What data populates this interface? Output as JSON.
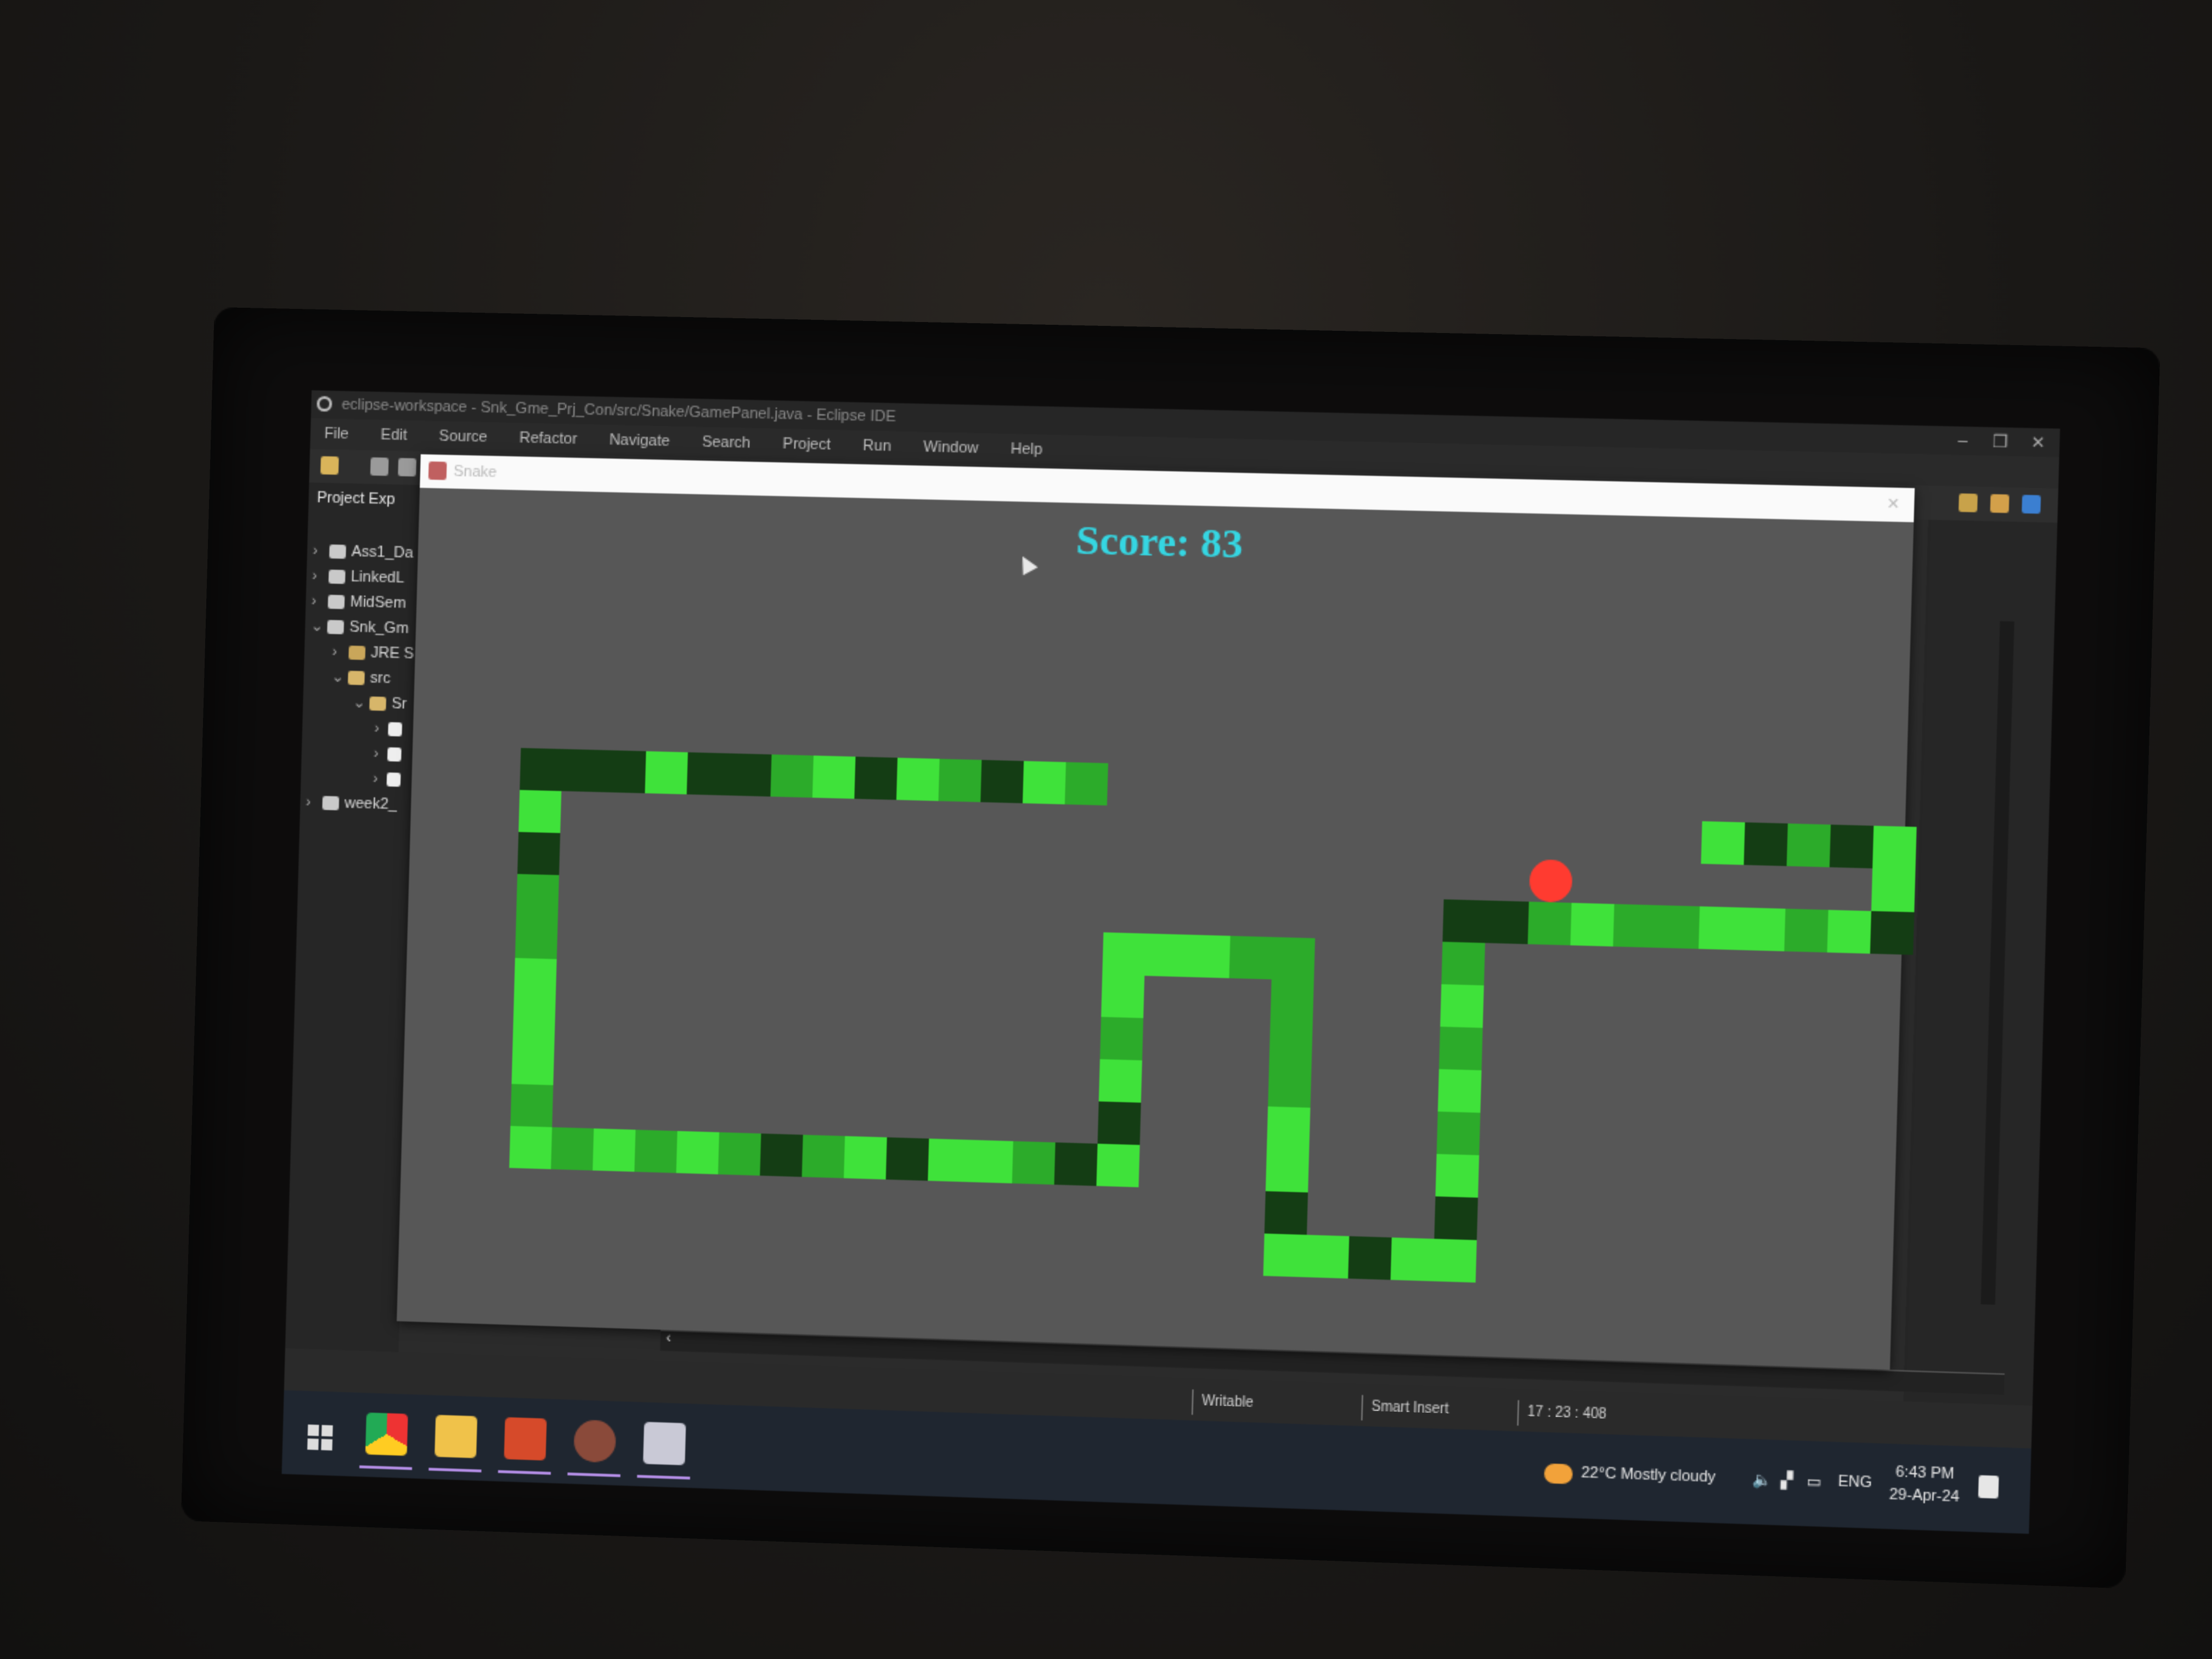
{
  "window": {
    "title": "eclipse-workspace - Snk_Gme_Prj_Con/src/Snake/GamePanel.java - Eclipse IDE",
    "controls": [
      "–",
      "❐",
      "✕"
    ]
  },
  "menu": [
    "File",
    "Edit",
    "Source",
    "Refactor",
    "Navigate",
    "Search",
    "Project",
    "Run",
    "Window",
    "Help"
  ],
  "explorer": {
    "title": "Project Exp",
    "items": [
      {
        "chevron": "›",
        "label": "Ass1_Da"
      },
      {
        "chevron": "›",
        "label": "LinkedL"
      },
      {
        "chevron": "›",
        "label": "MidSem"
      },
      {
        "chevron": "⌄",
        "label": "Snk_Gm"
      },
      {
        "chevron": "›",
        "label": "JRE S"
      },
      {
        "chevron": "⌄",
        "label": "src"
      },
      {
        "chevron": "⌄",
        "label": "Sr"
      },
      {
        "chevron": "›",
        "label": ""
      },
      {
        "chevron": "›",
        "label": ""
      },
      {
        "chevron": "›",
        "label": ""
      },
      {
        "chevron": "›",
        "label": "week2_"
      }
    ]
  },
  "game": {
    "window_title": "Snake",
    "close": "✕",
    "score_text": "Score: 83",
    "apple_color": "#ff3b30",
    "snake_bright": "#3fe23a",
    "snake_mid": "#2cab2a",
    "snake_dark": "#143d14",
    "grid": {
      "cols": 35,
      "rows": 20
    },
    "apple": [
      25,
      7
    ],
    "snake_segments": [
      [
        33,
        6,
        "b"
      ],
      [
        33,
        7,
        "b"
      ],
      [
        33,
        8,
        "d"
      ],
      [
        32,
        8,
        "b"
      ],
      [
        31,
        8,
        "m"
      ],
      [
        30,
        8,
        "b"
      ],
      [
        29,
        8,
        "b"
      ],
      [
        28,
        8,
        "m"
      ],
      [
        27,
        8,
        "m"
      ],
      [
        26,
        8,
        "b"
      ],
      [
        25,
        8,
        "m"
      ],
      [
        24,
        8,
        "d"
      ],
      [
        23,
        8,
        "d"
      ],
      [
        23,
        9,
        "m"
      ],
      [
        23,
        10,
        "b"
      ],
      [
        23,
        11,
        "m"
      ],
      [
        23,
        12,
        "b"
      ],
      [
        23,
        13,
        "m"
      ],
      [
        23,
        14,
        "b"
      ],
      [
        23,
        15,
        "d"
      ],
      [
        23,
        16,
        "b"
      ],
      [
        22,
        16,
        "b"
      ],
      [
        21,
        16,
        "d"
      ],
      [
        20,
        16,
        "b"
      ],
      [
        19,
        16,
        "b"
      ],
      [
        19,
        15,
        "d"
      ],
      [
        19,
        14,
        "b"
      ],
      [
        19,
        13,
        "b"
      ],
      [
        19,
        12,
        "m"
      ],
      [
        19,
        11,
        "m"
      ],
      [
        19,
        10,
        "m"
      ],
      [
        19,
        9,
        "m"
      ],
      [
        18,
        9,
        "m"
      ],
      [
        17,
        9,
        "b"
      ],
      [
        16,
        9,
        "b"
      ],
      [
        15,
        9,
        "b"
      ],
      [
        15,
        10,
        "b"
      ],
      [
        15,
        11,
        "m"
      ],
      [
        15,
        12,
        "b"
      ],
      [
        15,
        13,
        "d"
      ],
      [
        15,
        14,
        "b"
      ],
      [
        14,
        14,
        "d"
      ],
      [
        13,
        14,
        "m"
      ],
      [
        12,
        14,
        "b"
      ],
      [
        11,
        14,
        "b"
      ],
      [
        10,
        14,
        "d"
      ],
      [
        9,
        14,
        "b"
      ],
      [
        8,
        14,
        "m"
      ],
      [
        7,
        14,
        "d"
      ],
      [
        6,
        14,
        "m"
      ],
      [
        5,
        14,
        "b"
      ],
      [
        4,
        14,
        "m"
      ],
      [
        3,
        14,
        "b"
      ],
      [
        2,
        14,
        "m"
      ],
      [
        1,
        14,
        "b"
      ],
      [
        1,
        13,
        "m"
      ],
      [
        1,
        12,
        "b"
      ],
      [
        1,
        11,
        "b"
      ],
      [
        1,
        10,
        "b"
      ],
      [
        1,
        9,
        "m"
      ],
      [
        1,
        8,
        "m"
      ],
      [
        1,
        7,
        "d"
      ],
      [
        1,
        6,
        "b"
      ],
      [
        1,
        5,
        "d"
      ],
      [
        2,
        5,
        "d"
      ],
      [
        3,
        5,
        "d"
      ],
      [
        4,
        5,
        "b"
      ],
      [
        5,
        5,
        "d"
      ],
      [
        6,
        5,
        "d"
      ],
      [
        7,
        5,
        "m"
      ],
      [
        8,
        5,
        "b"
      ],
      [
        9,
        5,
        "d"
      ],
      [
        10,
        5,
        "b"
      ],
      [
        11,
        5,
        "m"
      ],
      [
        12,
        5,
        "d"
      ],
      [
        13,
        5,
        "b"
      ],
      [
        14,
        5,
        "m"
      ],
      [
        29,
        6,
        "b"
      ],
      [
        30,
        6,
        "d"
      ],
      [
        31,
        6,
        "m"
      ],
      [
        32,
        6,
        "d"
      ]
    ]
  },
  "statusbar": {
    "writable": "Writable",
    "insert_mode": "Smart Insert",
    "position": "17 : 23 : 408"
  },
  "taskbar": {
    "weather": "22°C  Mostly cloudy",
    "lang": "ENG",
    "time": "6:43 PM",
    "date": "29-Apr-24",
    "apps": [
      "chrome-icon",
      "file-explorer-icon",
      "powerpoint-icon",
      "game-app-icon",
      "java-app-icon"
    ]
  }
}
